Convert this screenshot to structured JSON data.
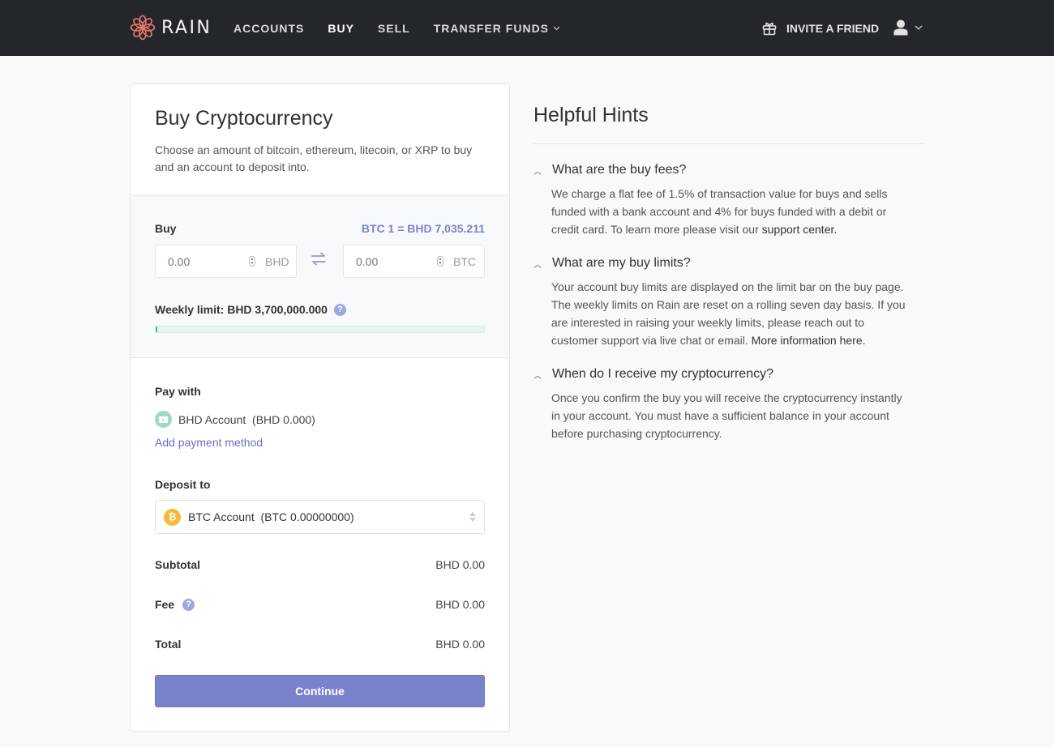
{
  "nav": {
    "brand": "RAIN",
    "brand_color": "#e8776a",
    "items": [
      {
        "label": "ACCOUNTS",
        "active": false
      },
      {
        "label": "BUY",
        "active": true
      },
      {
        "label": "SELL",
        "active": false
      },
      {
        "label": "TRANSFER FUNDS",
        "active": false,
        "has_dropdown": true
      }
    ],
    "invite_label": "INVITE A FRIEND",
    "invite_icon": "gift-icon",
    "user_icon": "user-icon"
  },
  "buy_card": {
    "title": "Buy Cryptocurrency",
    "subtitle": "Choose an amount of bitcoin, ethereum, litecoin, or XRP to buy and an account to deposit into.",
    "buy_label": "Buy",
    "rate": "BTC 1 = BHD 7,035.211",
    "fiat_input": {
      "placeholder": "0.00",
      "value": "",
      "currency": "BHD"
    },
    "crypto_input": {
      "placeholder": "0.00",
      "value": "",
      "currency": "BTC"
    },
    "weekly_limit_label": "Weekly limit: BHD 3,700,000.000",
    "weekly_limit_used_fraction": 0.0,
    "pay_with_label": "Pay with",
    "pay_account": "BHD Account  (BHD 0.000)",
    "add_payment_label": "Add payment method",
    "deposit_label": "Deposit to",
    "deposit_selected": "BTC Account  (BTC 0.00000000)",
    "summary": {
      "subtotal_label": "Subtotal",
      "subtotal_value": "BHD 0.00",
      "fee_label": "Fee",
      "fee_value": "BHD 0.00",
      "total_label": "Total",
      "total_value": "BHD 0.00"
    },
    "continue_label": "Continue",
    "accent_color": "#7a82cb"
  },
  "hints": {
    "title": "Helpful Hints",
    "items": [
      {
        "question": "What are the buy fees?",
        "answer": "We charge a flat fee of 1.5% of transaction value for buys and sells funded with a bank account and 4% for buys funded with a debit or credit card. To learn more please visit our ",
        "link": "support center."
      },
      {
        "question": "What are my buy limits?",
        "answer": "Your account buy limits are displayed on the limit bar on the buy page. The weekly limits on Rain are reset on a rolling seven day basis. If you are interested in raising your weekly limits, please reach out to customer support via live chat or email. ",
        "link": "More information here."
      },
      {
        "question": "When do I receive my cryptocurrency?",
        "answer": "Once you confirm the buy you will receive the cryptocurrency instantly in your account. You must have a sufficient balance in your account before purchasing cryptocurrency.",
        "link": ""
      }
    ]
  }
}
